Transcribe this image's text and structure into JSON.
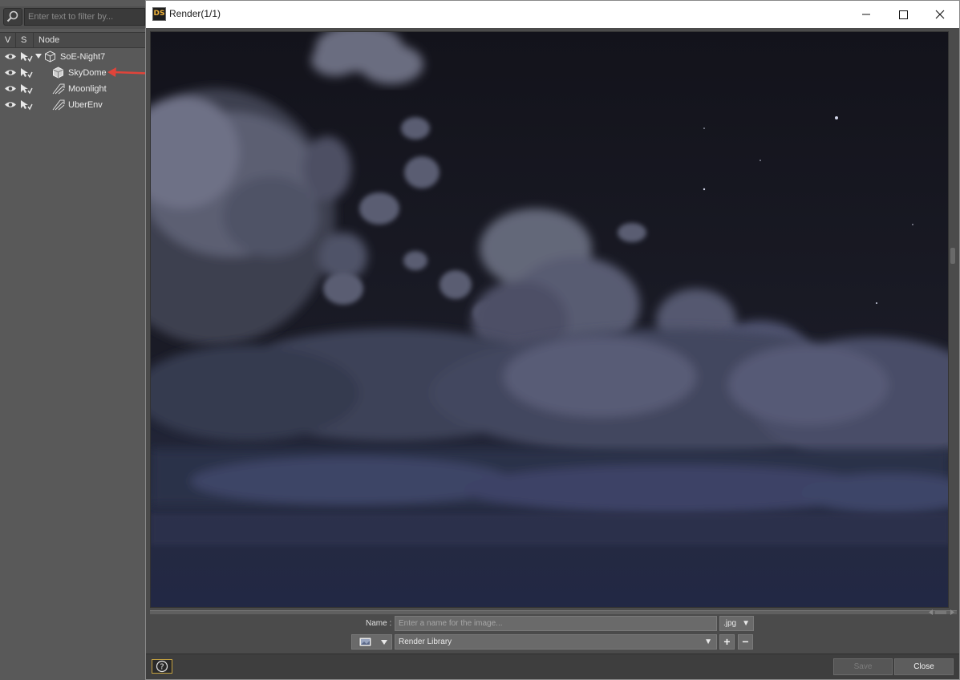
{
  "scene": {
    "filter_placeholder": "Enter text to filter by...",
    "columns": {
      "v": "V",
      "s": "S",
      "node": "Node"
    },
    "nodes": [
      {
        "label": "SoE-Night7",
        "icon": "group-node-icon",
        "expanded": true
      },
      {
        "label": "SkyDome",
        "icon": "skydome-node-icon"
      },
      {
        "label": "Moonlight",
        "icon": "light-node-icon"
      },
      {
        "label": "UberEnv",
        "icon": "light-node-icon"
      }
    ],
    "annotation_color": "#e0443a"
  },
  "render_window": {
    "app_icon_text": "DS",
    "title": "Render(1/1)",
    "name_label": "Name :",
    "name_placeholder": "Enter a name for the image...",
    "format": ".jpg",
    "library": "Render Library",
    "add_label": "+",
    "remove_label": "−",
    "help_label": "?",
    "save_label": "Save",
    "close_label": "Close"
  }
}
